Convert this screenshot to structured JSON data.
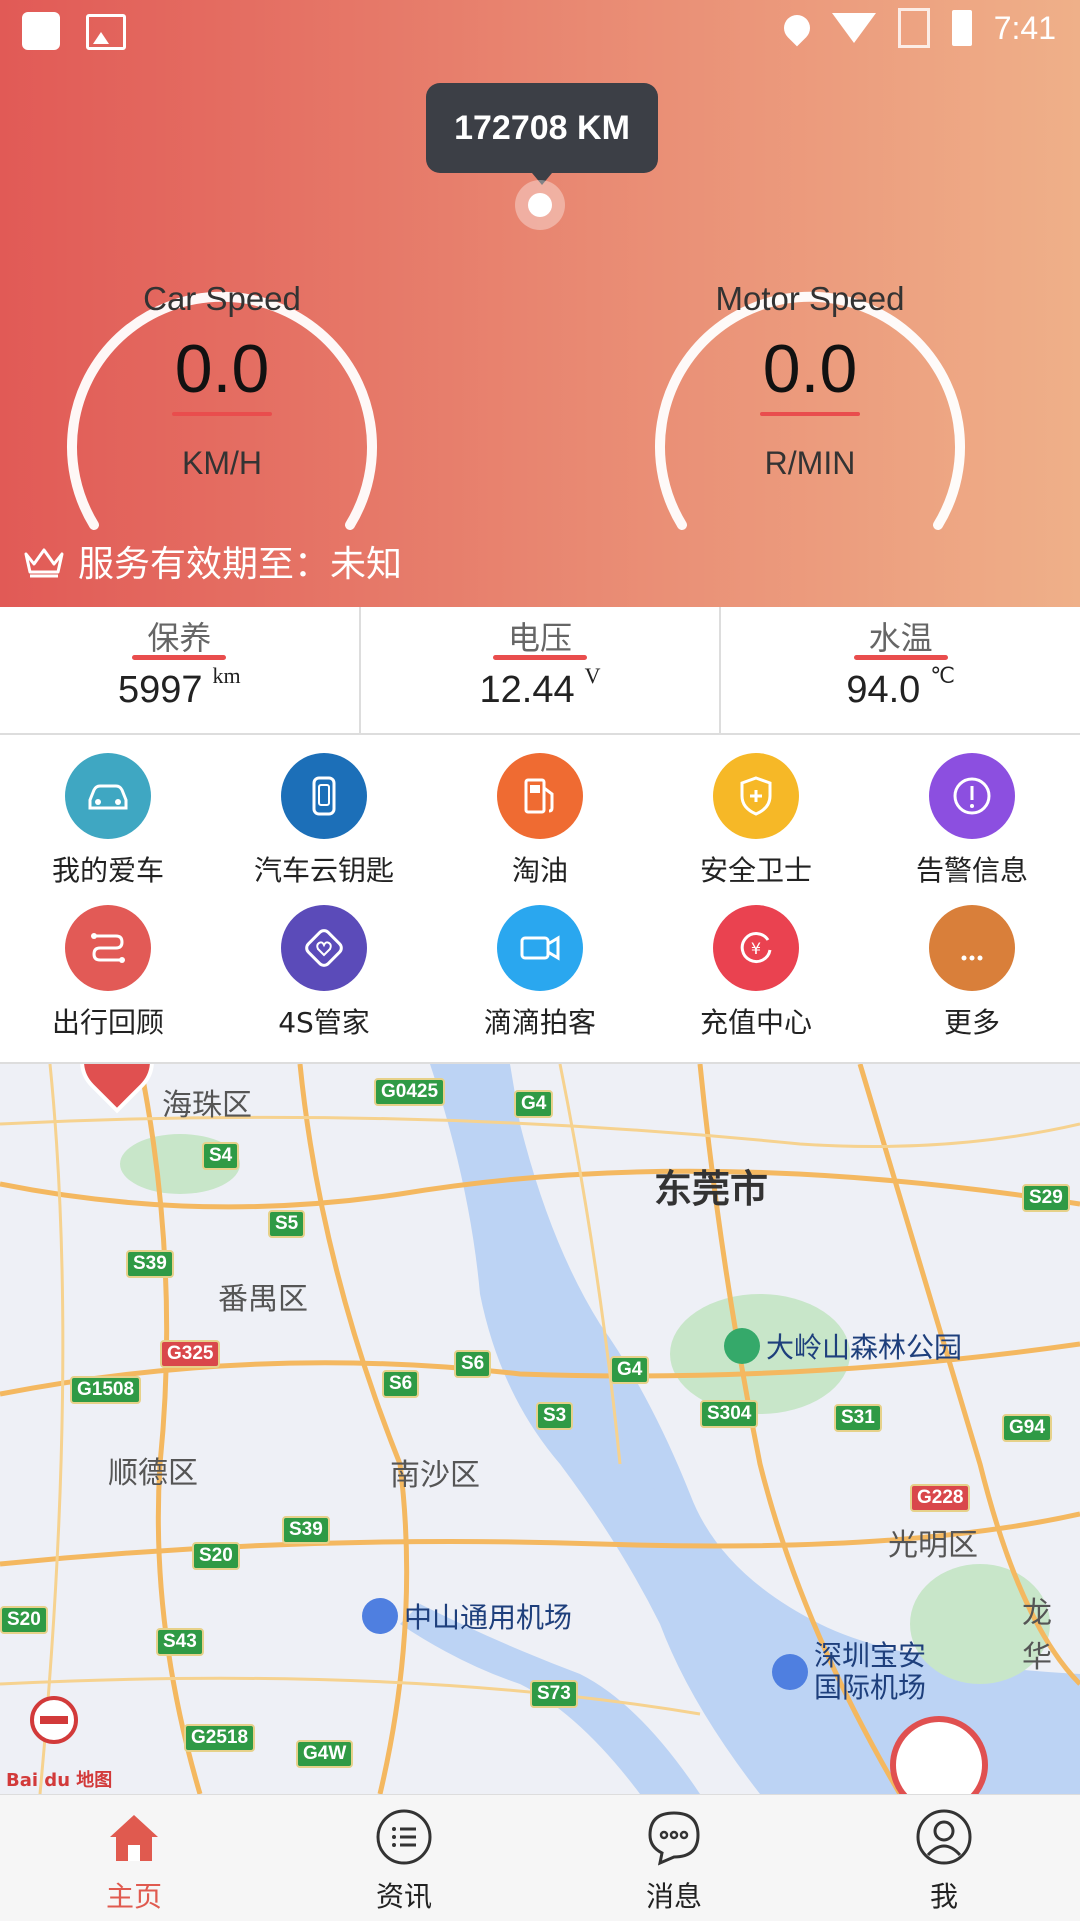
{
  "status_bar": {
    "time": "7:41"
  },
  "odometer": {
    "label": "172708 KM"
  },
  "gauges": {
    "car": {
      "title": "Car Speed",
      "value": "0.0",
      "unit": "KM/H"
    },
    "motor": {
      "title": "Motor Speed",
      "value": "0.0",
      "unit": "R/MIN"
    }
  },
  "service": {
    "text": "服务有效期至：未知"
  },
  "metrics": [
    {
      "label": "保养",
      "value": "5997",
      "unit": "km"
    },
    {
      "label": "电压",
      "value": "12.44",
      "unit": "V"
    },
    {
      "label": "水温",
      "value": "94.0",
      "unit": "℃"
    }
  ],
  "grid": [
    {
      "label": "我的爱车",
      "icon": "car-icon",
      "color": "#3fa7c2"
    },
    {
      "label": "汽车云钥匙",
      "icon": "key-fob-icon",
      "color": "#1c6fb8"
    },
    {
      "label": "淘油",
      "icon": "fuel-pump-icon",
      "color": "#ef6b32"
    },
    {
      "label": "安全卫士",
      "icon": "shield-icon",
      "color": "#f6b827"
    },
    {
      "label": "告警信息",
      "icon": "alert-icon",
      "color": "#8c4fe0"
    },
    {
      "label": "出行回顾",
      "icon": "route-icon",
      "color": "#e25a56"
    },
    {
      "label": "4S管家",
      "icon": "heart-badge-icon",
      "color": "#5b4bb9"
    },
    {
      "label": "滴滴拍客",
      "icon": "camera-icon",
      "color": "#2aa7ef"
    },
    {
      "label": "充值中心",
      "icon": "recharge-icon",
      "color": "#ea4250"
    },
    {
      "label": "更多",
      "icon": "more-icon",
      "color": "#d97f3a"
    }
  ],
  "map": {
    "districts": [
      "海珠区",
      "番禺区",
      "顺德区",
      "南沙区",
      "光明区",
      "龙华"
    ],
    "city": "东莞市",
    "pois": [
      "大岭山森林公园",
      "中山通用机场",
      "深圳宝安",
      "国际机场"
    ],
    "roads": [
      "G0425",
      "G4",
      "S4",
      "S5",
      "S39",
      "G325",
      "G1508",
      "S6",
      "S6",
      "S3",
      "G4",
      "S304",
      "S31",
      "G94",
      "S29",
      "G228",
      "S39",
      "S20",
      "S20",
      "S43",
      "G2518",
      "G4W",
      "S73"
    ],
    "brand": "Bai du 地图"
  },
  "bottom_nav": [
    {
      "label": "主页",
      "icon": "home-icon",
      "active": true
    },
    {
      "label": "资讯",
      "icon": "list-icon",
      "active": false
    },
    {
      "label": "消息",
      "icon": "message-icon",
      "active": false
    },
    {
      "label": "我",
      "icon": "profile-icon",
      "active": false
    }
  ]
}
